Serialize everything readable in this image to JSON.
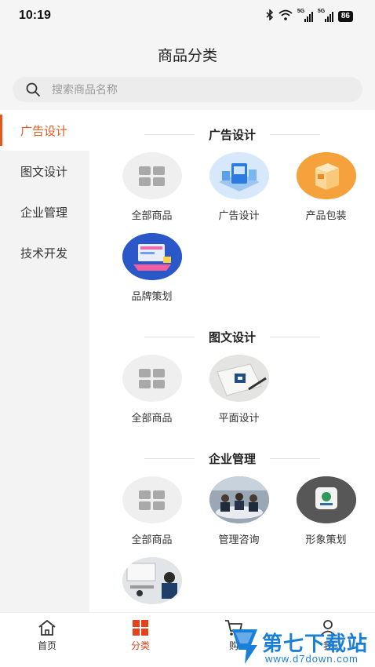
{
  "status": {
    "time": "10:19",
    "signal1": "5G",
    "signal2": "5G",
    "battery": "86"
  },
  "header": {
    "title": "商品分类"
  },
  "search": {
    "placeholder": "搜索商品名称"
  },
  "sidebar": {
    "items": [
      {
        "label": "广告设计",
        "active": true
      },
      {
        "label": "图文设计",
        "active": false
      },
      {
        "label": "企业管理",
        "active": false
      },
      {
        "label": "技术开发",
        "active": false
      }
    ]
  },
  "sections": [
    {
      "title": "广告设计",
      "items": [
        {
          "label": "全部商品",
          "icon": "grid-icon"
        },
        {
          "label": "广告设计",
          "icon": "ad-design-image"
        },
        {
          "label": "产品包装",
          "icon": "package-image"
        },
        {
          "label": "品牌策划",
          "icon": "brand-planning-image"
        }
      ]
    },
    {
      "title": "图文设计",
      "items": [
        {
          "label": "全部商品",
          "icon": "grid-icon"
        },
        {
          "label": "平面设计",
          "icon": "graphic-design-image"
        }
      ]
    },
    {
      "title": "企业管理",
      "items": [
        {
          "label": "全部商品",
          "icon": "grid-icon"
        },
        {
          "label": "管理咨询",
          "icon": "consulting-image"
        },
        {
          "label": "形象策划",
          "icon": "image-planning-image"
        },
        {
          "label": "",
          "icon": "training-image"
        }
      ]
    }
  ],
  "bottom_nav": {
    "items": [
      {
        "label": "首页",
        "icon": "home-icon",
        "active": false
      },
      {
        "label": "分类",
        "icon": "category-icon",
        "active": true
      },
      {
        "label": "购",
        "icon": "cart-icon",
        "active": false
      },
      {
        "label": "我",
        "icon": "user-icon",
        "active": false
      }
    ]
  },
  "watermark": {
    "brand": "第七下载站",
    "url": "www.d7down.com"
  },
  "colors": {
    "accent": "#e55a1b",
    "nav_active": "#e5421b",
    "watermark": "#1a7fd6"
  }
}
